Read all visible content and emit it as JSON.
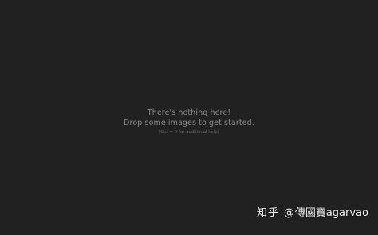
{
  "viewer": {
    "empty_title": "There's nothing here!",
    "empty_message": "Drop some images to get started.",
    "shortcut_hint": "(Ctrl + H for additional help)"
  },
  "watermark": {
    "site": "知乎",
    "at": "@",
    "author": "傳國寶",
    "handle": "agarvao"
  },
  "colors": {
    "background": "#212121",
    "message_text": "#8a8a8a",
    "hint_text": "#6f6f6f",
    "watermark_text": "#f0f0f0"
  }
}
